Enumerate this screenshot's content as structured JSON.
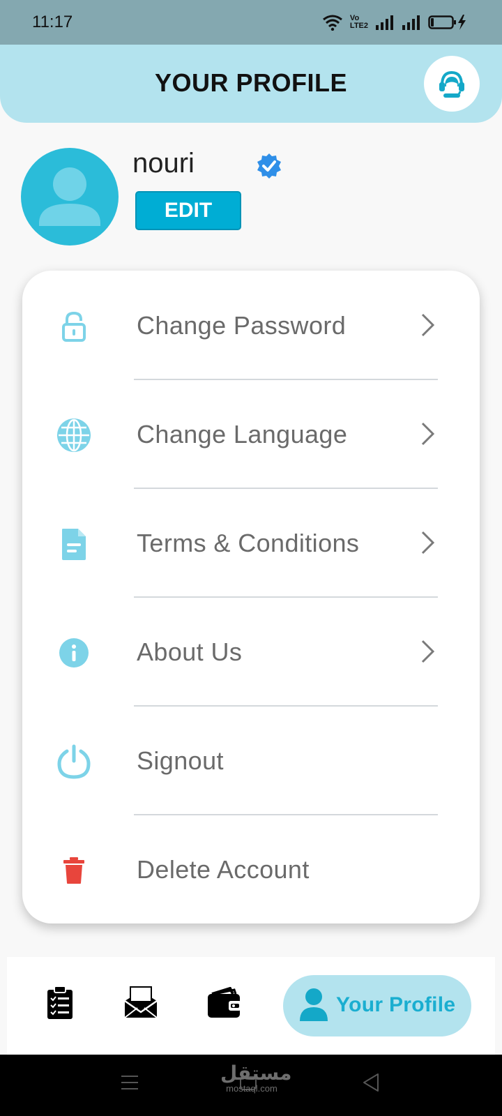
{
  "status_bar": {
    "time": "11:17",
    "volte_label_top": "Vo",
    "volte_label_bottom": "LTE2"
  },
  "header": {
    "title": "YOUR PROFILE",
    "support_icon": "headset-support-icon"
  },
  "profile": {
    "username": "nouri",
    "verified": true,
    "edit_label": "EDIT",
    "avatar_icon": "user-avatar-icon"
  },
  "menu": {
    "items": [
      {
        "label": "Change Password",
        "icon": "lock-icon",
        "has_chevron": true
      },
      {
        "label": "Change Language",
        "icon": "globe-icon",
        "has_chevron": true
      },
      {
        "label": "Terms & Conditions",
        "icon": "document-icon",
        "has_chevron": true
      },
      {
        "label": "About Us",
        "icon": "info-icon",
        "has_chevron": true
      },
      {
        "label": "Signout",
        "icon": "power-icon",
        "has_chevron": false
      },
      {
        "label": "Delete Account",
        "icon": "trash-icon",
        "has_chevron": false
      }
    ]
  },
  "bottom_nav": {
    "items": [
      {
        "icon": "clipboard-checklist-icon"
      },
      {
        "icon": "mail-icon"
      },
      {
        "icon": "wallet-icon"
      }
    ],
    "active_label": "Your Profile",
    "active_icon": "person-icon"
  },
  "watermark": {
    "arabic": "مستقل",
    "latin": "mostaql.com"
  },
  "colors": {
    "accent": "#00add4",
    "header_bg": "#b3e3ee",
    "icon": "#7dd3e8",
    "danger": "#e8453c"
  }
}
